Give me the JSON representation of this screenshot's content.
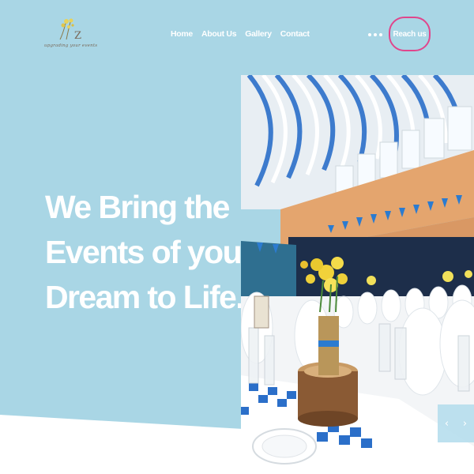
{
  "brand": {
    "tagline": "upgrading your events",
    "logo_letter": "Z"
  },
  "nav": {
    "items": [
      "Home",
      "About Us",
      "Gallery",
      "Contact"
    ]
  },
  "more_icon": "ellipsis-icon",
  "cta": {
    "label": "Reach us"
  },
  "hero": {
    "headline_lines": [
      "We Bring the",
      "Events of your",
      "Dream to Life."
    ]
  },
  "slider": {
    "prev_icon": "‹",
    "next_icon": "›"
  },
  "colors": {
    "hero_background": "#a9d6e5",
    "cta_border": "#e0468c",
    "text": "#ffffff"
  }
}
